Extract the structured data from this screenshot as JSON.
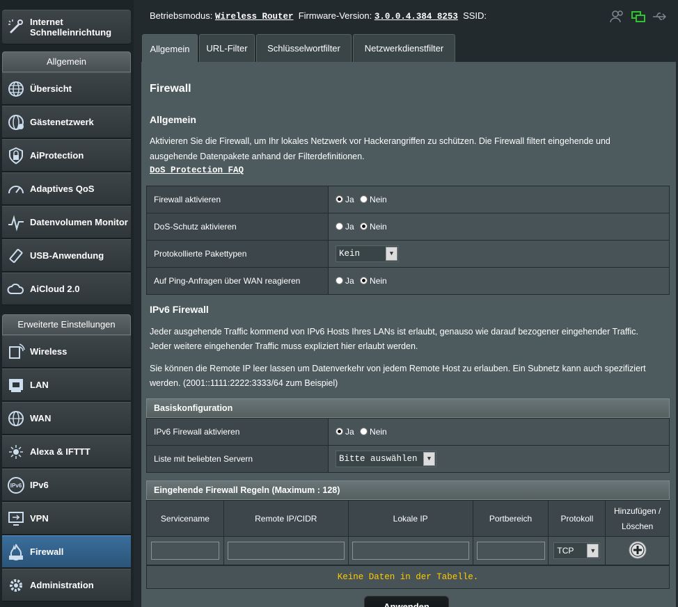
{
  "sidebar": {
    "quick_setup": "Internet Schnelleinrichtung",
    "general_header": "Allgemein",
    "general_items": [
      "Übersicht",
      "Gästenetzwerk",
      "AiProtection",
      "Adaptives QoS",
      "Datenvolumen Monitor",
      "USB-Anwendung",
      "AiCloud 2.0"
    ],
    "advanced_header": "Erweiterte Einstellungen",
    "advanced_items": [
      "Wireless",
      "LAN",
      "WAN",
      "Alexa & IFTTT",
      "IPv6",
      "VPN",
      "Firewall",
      "Administration"
    ],
    "active_item": "Firewall"
  },
  "topbar": {
    "mode_label": "Betriebsmodus:",
    "mode_value": "Wireless Router",
    "fw_label": "Firmware-Version:",
    "fw_value": "3.0.0.4.384_8253",
    "ssid_label": "SSID:"
  },
  "tabs": [
    "Allgemein",
    "URL-Filter",
    "Schlüsselwortfilter",
    "Netzwerkdienstfilter"
  ],
  "active_tab": "Allgemein",
  "page": {
    "title": "Firewall",
    "general_title": "Allgemein",
    "general_desc_1": "Aktivieren Sie die Firewall, um Ihr lokales Netzwerk vor Hackerangriffen zu schützen. Die Firewall filtert eingehende und",
    "general_desc_2": "ausgehende Datenpakete anhand der Filterdefinitionen.",
    "dos_faq": "DoS Protection FAQ",
    "settings": [
      {
        "label": "Firewall aktivieren",
        "selected": "Ja"
      },
      {
        "label": "DoS-Schutz aktivieren",
        "selected": "Nein"
      },
      {
        "label": "Protokollierte Pakettypen",
        "select_value": "Kein"
      },
      {
        "label": "Auf Ping-Anfragen über WAN reagieren",
        "selected": "Nein"
      }
    ],
    "yes": "Ja",
    "no": "Nein",
    "ipv6_title": "IPv6 Firewall",
    "ipv6_desc_1": "Jeder ausgehende Traffic kommend von IPv6 Hosts Ihres LANs ist erlaubt, genauso wie darauf bezogener eingehender Traffic.",
    "ipv6_desc_2": "Jeder weitere eingehender Traffic muss expliziert hier erlaubt werden.",
    "ipv6_desc_3": "Sie können die Remote IP leer lassen um Datenverkehr von jedem Remote Host zu erlauben. Ein Subnetz kann auch spezifiziert",
    "ipv6_desc_4": "werden. (2001::1111:2222:3333/64 zum Beispiel)",
    "basic_config": "Basiskonfiguration",
    "ipv6_enable_label": "IPv6 Firewall aktivieren",
    "ipv6_enable_selected": "Ja",
    "servers_label": "Liste mit beliebten Servern",
    "servers_value": "Bitte auswählen",
    "rules_title": "Eingehende Firewall Regeln (Maximum : 128)",
    "columns": [
      "Servicename",
      "Remote IP/CIDR",
      "Lokale IP",
      "Portbereich",
      "Protokoll",
      "Hinzufügen / Löschen"
    ],
    "protocol_value": "TCP",
    "no_data": "Keine Daten in der Tabelle.",
    "apply": "Anwenden"
  }
}
